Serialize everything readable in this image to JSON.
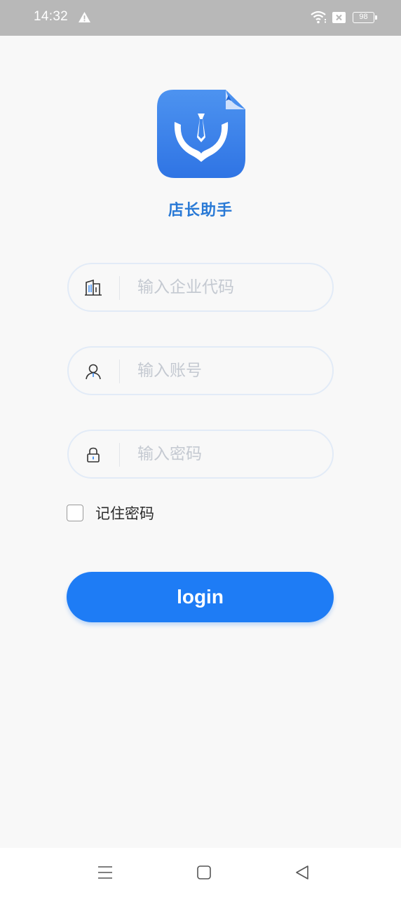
{
  "status_bar": {
    "time": "14:32",
    "battery_level": "98",
    "icons": [
      "warning-icon",
      "wifi-icon",
      "sim-x-icon",
      "battery-icon"
    ]
  },
  "app": {
    "name": "店长助手",
    "logo_icon": "app-logo-icon",
    "brand_color": "#2a7ad6"
  },
  "form": {
    "company_code": {
      "placeholder": "输入企业代码",
      "value": "",
      "icon": "building-icon"
    },
    "account": {
      "placeholder": "输入账号",
      "value": "",
      "icon": "user-icon"
    },
    "password": {
      "placeholder": "输入密码",
      "value": "",
      "icon": "lock-icon"
    },
    "remember": {
      "label": "记住密码",
      "checked": false
    },
    "login_label": "login",
    "button_color": "#1e7cf5"
  },
  "nav_bar": {
    "buttons": [
      "menu-icon",
      "home-square-icon",
      "back-triangle-icon"
    ]
  }
}
